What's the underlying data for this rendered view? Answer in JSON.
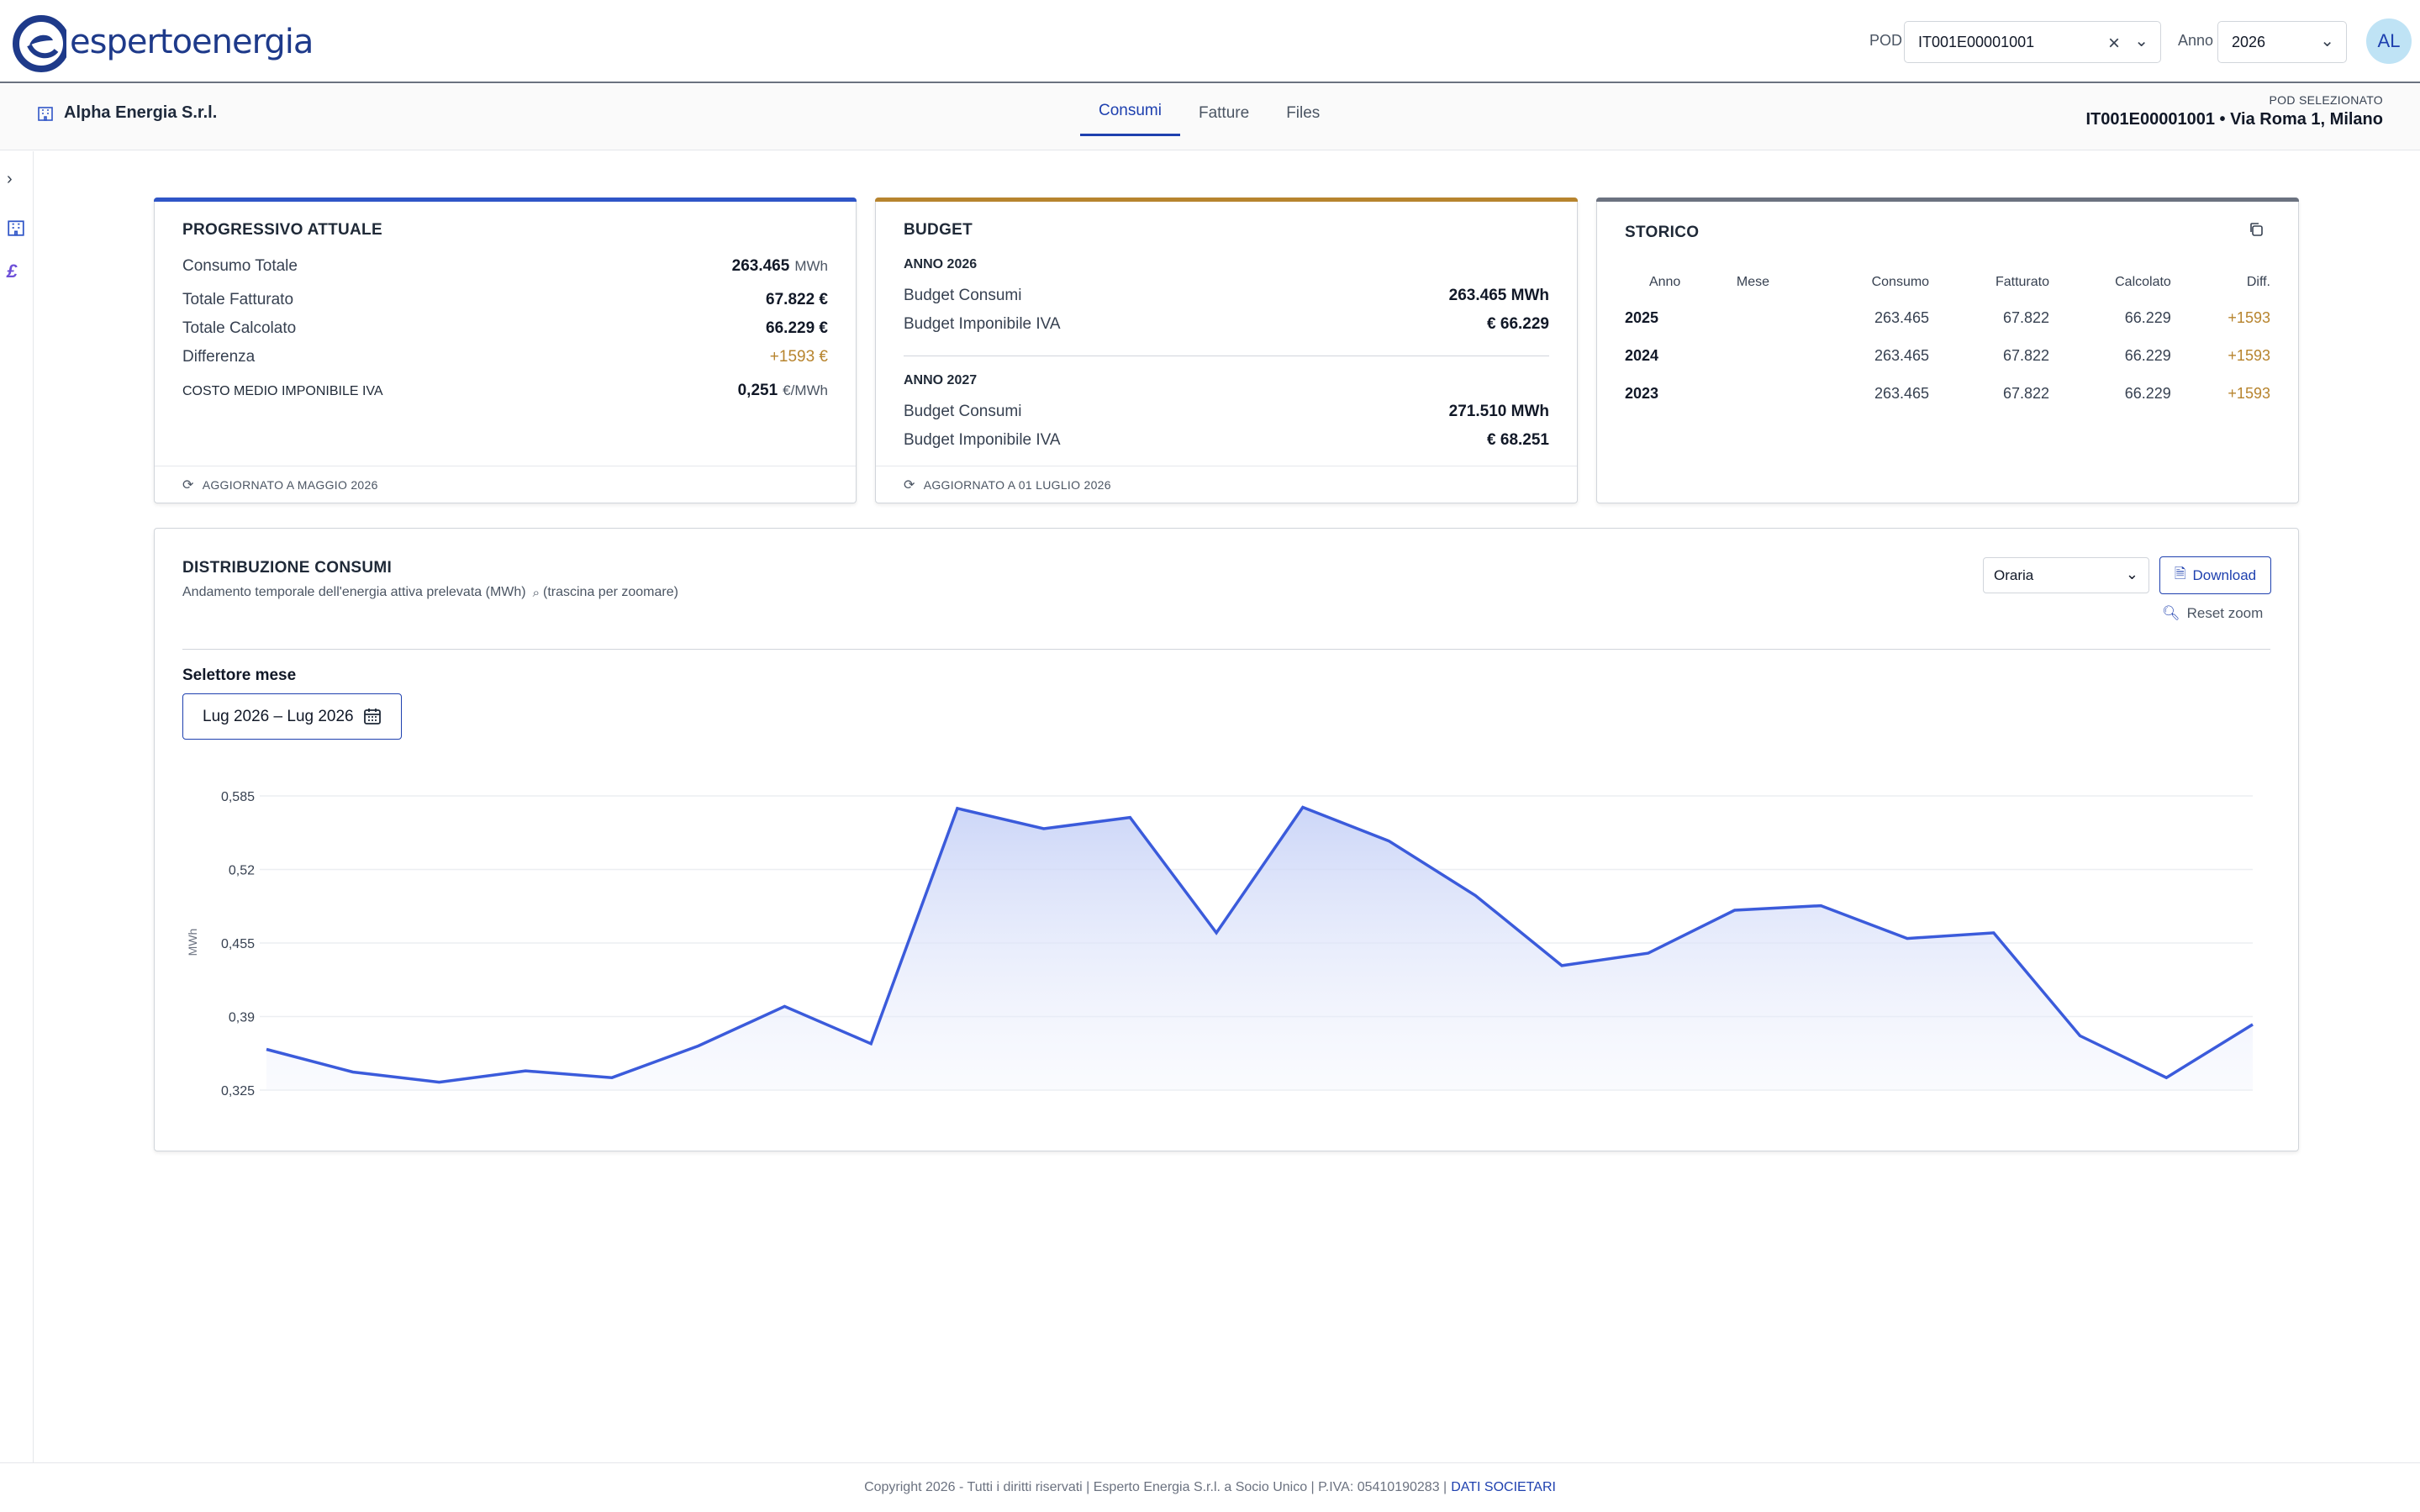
{
  "brand": {
    "name": "espertoenergia"
  },
  "header": {
    "pod_label": "POD",
    "pod_value": "IT001E00001001",
    "year_label": "Anno",
    "year_value": "2026",
    "avatar_initials": "AL"
  },
  "subheader": {
    "company": "Alpha Energia S.r.l.",
    "tabs": [
      {
        "label": "Consumi",
        "active": true
      },
      {
        "label": "Fatture",
        "active": false
      },
      {
        "label": "Files",
        "active": false
      }
    ],
    "pod_selected_label": "POD SELEZIONATO",
    "pod_selected_value": "IT001E00001001 • Via Roma 1, Milano"
  },
  "progressivo": {
    "title": "PROGRESSIVO ATTUALE",
    "accent": "#2f55c7",
    "rows": [
      {
        "label": "Consumo Totale",
        "value": "263.465",
        "unit": "MWh"
      },
      {
        "label": "Totale Fatturato",
        "value": "67.822 €",
        "unit": ""
      },
      {
        "label": "Totale Calcolato",
        "value": "66.229 €",
        "unit": ""
      },
      {
        "label": "Differenza",
        "value": "+1593 €",
        "unit": ""
      },
      {
        "label": "COSTO MEDIO IMPONIBILE IVA",
        "value": "0,251",
        "unit": "€/MWh"
      }
    ],
    "footer": "AGGIORNATO A MAGGIO 2026"
  },
  "budget": {
    "title": "BUDGET",
    "accent": "#b7842e",
    "year1": "ANNO 2026",
    "year1_rows": [
      {
        "label": "Budget Consumi",
        "value": "263.465 MWh"
      },
      {
        "label": "Budget Imponibile IVA",
        "value": "€ 66.229"
      }
    ],
    "year2": "ANNO 2027",
    "year2_rows": [
      {
        "label": "Budget Consumi",
        "value": "271.510 MWh"
      },
      {
        "label": "Budget Imponibile IVA",
        "value": "€ 68.251"
      }
    ],
    "footer": "AGGIORNATO A 01 LUGLIO 2026"
  },
  "storico": {
    "title": "STORICO",
    "accent": "#6b7280",
    "columns": [
      "Anno",
      "Mese",
      "Consumo",
      "Fatturato",
      "Calcolato",
      "Diff."
    ],
    "rows": [
      {
        "anno": "2025",
        "mese": "",
        "consumo": "263.465",
        "fatturato": "67.822",
        "calcolato": "66.229",
        "diff": "+1593"
      },
      {
        "anno": "2024",
        "mese": "",
        "consumo": "263.465",
        "fatturato": "67.822",
        "calcolato": "66.229",
        "diff": "+1593"
      },
      {
        "anno": "2023",
        "mese": "",
        "consumo": "263.465",
        "fatturato": "67.822",
        "calcolato": "66.229",
        "diff": "+1593"
      }
    ]
  },
  "distribuzione": {
    "title": "DISTRIBUZIONE CONSUMI",
    "subtitle": "Andamento temporale dell'energia attiva prelevata (MWh)",
    "hint": "(trascina per zoomare)",
    "granularity": "Oraria",
    "download_label": "Download",
    "reset_label": "Reset zoom",
    "month_selector_label": "Selettore mese",
    "month_range": "Lug 2026 – Lug 2026"
  },
  "chart_data": {
    "type": "area",
    "ylabel": "MWh",
    "ylim": [
      0.325,
      0.585
    ],
    "yticks": [
      "0,585",
      "0,52",
      "0,455",
      "0,39",
      "0,325"
    ],
    "ytick_values": [
      0.585,
      0.52,
      0.455,
      0.39,
      0.325
    ],
    "grid": true,
    "color": "#3b5bdb",
    "values": [
      0.361,
      0.341,
      0.332,
      0.342,
      0.336,
      0.364,
      0.399,
      0.366,
      0.574,
      0.556,
      0.566,
      0.464,
      0.575,
      0.545,
      0.497,
      0.435,
      0.446,
      0.484,
      0.488,
      0.459,
      0.464,
      0.373,
      0.336,
      0.383
    ]
  },
  "footer": {
    "text": "Copyright 2026 - Tutti i diritti riservati | Esperto Energia S.r.l. a Socio Unico | P.IVA: 05410190283 |",
    "link": "DATI SOCIETARI"
  }
}
